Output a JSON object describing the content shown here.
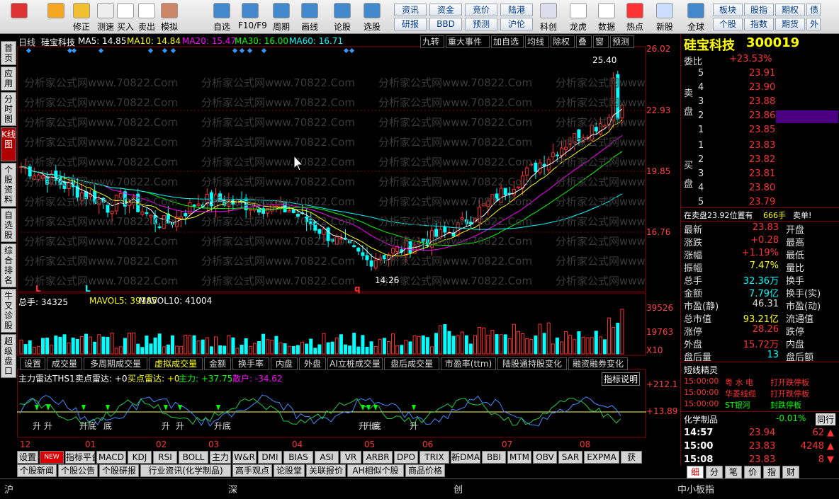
{
  "toolbar": {
    "items": [
      {
        "label": "",
        "icon": "windows-icon"
      },
      {
        "label": "",
        "icon": "back-arrow-icon"
      },
      {
        "label": "修正",
        "icon": "repair-icon"
      },
      {
        "label": "测速",
        "icon": "clock-icon"
      },
      {
        "label": "买入",
        "icon": "buy-icon"
      },
      {
        "label": "卖出",
        "icon": "sell-icon"
      },
      {
        "label": "模拟",
        "icon": "hammer-icon"
      },
      {
        "label": "自选",
        "icon": "star-icon"
      },
      {
        "label": "F10/F9",
        "icon": "f10-icon"
      },
      {
        "label": "周期",
        "icon": "period-clock-icon"
      },
      {
        "label": "画线",
        "icon": "pencil-icon"
      },
      {
        "label": "论股",
        "icon": "discuss-icon"
      },
      {
        "label": "选股",
        "icon": "speedometer-icon"
      }
    ],
    "grid": [
      [
        "资讯",
        "资金",
        "竞价",
        "陆港"
      ],
      [
        "研报",
        "BBD",
        "预测",
        "沪伦"
      ]
    ],
    "right_items": [
      {
        "label": "科创",
        "icon": "chart-icon"
      },
      {
        "label": "龙虎",
        "icon": "dragon-icon"
      },
      {
        "label": "数据",
        "icon": "pe-icon"
      },
      {
        "label": "热点",
        "icon": "hot-icon"
      },
      {
        "label": "新股",
        "icon": "new-stock-icon"
      },
      {
        "label": "全球",
        "icon": "globe-icon"
      }
    ],
    "grid2": [
      [
        "板块",
        "股指",
        "期权",
        "债"
      ],
      [
        "个股",
        "指数",
        "期货",
        "外"
      ]
    ]
  },
  "left_tabs": [
    "首页",
    "应用",
    "分时图",
    "K线图",
    "个股资料",
    "自选股",
    "综合排名",
    "牛叉诊股",
    "超级盘口"
  ],
  "chart_header": {
    "period": "日线",
    "name": "硅宝科技",
    "ma5": "MA5: 14.85",
    "ma10": "MA10: 14.84",
    "ma20": "MA20: 15.47",
    "ma30": "MA30: 16.00",
    "ma60": "MA60: 16.71",
    "buttons": [
      "九转",
      "重大事件",
      "加自选",
      "均线",
      "除权",
      "叠",
      "窗",
      "预测"
    ]
  },
  "watermark": "分析家公式网www.70822.Com",
  "price_axis": [
    "26.02",
    "22.93",
    "19.85",
    "16.76"
  ],
  "annotations": {
    "high": "25.40",
    "low": "14.26",
    "markers": [
      "L",
      "L",
      "q"
    ]
  },
  "volume_header": {
    "total": "总手: 34325",
    "mavol5": "MAVOL5: 39185",
    "mavol10": "MAVOL10: 41004"
  },
  "volume_axis": [
    "39526",
    "19763",
    "X10"
  ],
  "indicator_tabs": [
    "设置",
    "成交量",
    "多周期成交量",
    "虚拟成交量",
    "金额",
    "换手率",
    "内盘",
    "外盘",
    "AI立桩成交量",
    "盘后成交量",
    "市盈率(ttm)",
    "陆股通持股变化",
    "融资融券变化"
  ],
  "radar_header": {
    "title": "主力雷达THS1",
    "s1": "卖点雷达: +0",
    "s2": "买点雷达: +0",
    "s3": "主力: +37.75",
    "s4": "散户: -34.62",
    "explain": "指标说明"
  },
  "radar_axis": [
    "+212.1",
    "+13.89"
  ],
  "radar_labels": [
    "升",
    "升",
    "升底",
    "底",
    "升",
    "升",
    "升底",
    "升",
    "升底",
    "底",
    "升"
  ],
  "months": [
    "12",
    "01",
    "02",
    "03",
    "04",
    "05",
    "06",
    "07",
    "08"
  ],
  "bottom_tabs": [
    "设置",
    "NEW",
    "指标平台",
    "MACD",
    "KDJ",
    "RSI",
    "BOLL",
    "主力",
    "W&R",
    "DMI",
    "BIAS",
    "ASI",
    "VR",
    "ARBR",
    "DPO",
    "TRIX",
    "新DMA",
    "BBI",
    "MTM",
    "OBV",
    "SAR",
    "EXPMA",
    "获"
  ],
  "news_tabs": [
    "个股新闻",
    "个股公告",
    "个股研报",
    "行业资讯(化学制品)",
    "高手观点",
    "论股堂",
    "关联报价",
    "AH相似个股",
    "商品价格"
  ],
  "stock": {
    "name": "硅宝科技",
    "code": "300019"
  },
  "orderbook": {
    "weibi_label": "委比",
    "weibi": "+23.53%",
    "sell_label": "卖盘",
    "buy_label": "买盘",
    "sell": [
      {
        "lvl": "5",
        "price": "23.91"
      },
      {
        "lvl": "4",
        "price": "23.90"
      },
      {
        "lvl": "3",
        "price": "23.88"
      },
      {
        "lvl": "2",
        "price": "23.86"
      },
      {
        "lvl": "1",
        "price": "23.85"
      }
    ],
    "buy": [
      {
        "lvl": "1",
        "price": "23.83"
      },
      {
        "lvl": "2",
        "price": "23.82"
      },
      {
        "lvl": "3",
        "price": "23.81"
      },
      {
        "lvl": "4",
        "price": "23.80"
      },
      {
        "lvl": "5",
        "price": "23.79"
      }
    ],
    "info": "在卖盘23.92位置有",
    "info_vol": "666手",
    "info_tag": "卖单!"
  },
  "quote": [
    {
      "l": "最新",
      "v": "23.83",
      "r": "开盘"
    },
    {
      "l": "涨跌",
      "v": "+0.28",
      "r": "最高"
    },
    {
      "l": "涨幅",
      "v": "+1.19%",
      "r": "最低"
    },
    {
      "l": "振幅",
      "v": "7.47%",
      "r": "量比"
    },
    {
      "l": "总手",
      "v": "32.36万",
      "r": "换手"
    },
    {
      "l": "金额",
      "v": "7.79亿",
      "r": "换手(实)"
    },
    {
      "l": "市盈(静)",
      "v": "46.31",
      "r": "市盈(动)"
    },
    {
      "l": "总市值",
      "v": "93.21亿",
      "r": "流通值"
    },
    {
      "l": "涨停",
      "v": "28.26",
      "r": "跌停"
    },
    {
      "l": "外盘",
      "v": "15.72万",
      "r": "内盘"
    },
    {
      "l": "盘后量",
      "v": "13",
      "r": "盘后额"
    }
  ],
  "short_title": "短线精灵",
  "short_list": [
    {
      "t": "15:00:00",
      "n": "粤 水 电",
      "e": "打开跌停板"
    },
    {
      "t": "15:00:00",
      "n": "华菱线缆",
      "e": "打开跌停板"
    },
    {
      "t": "15:00:00",
      "n": "ST银河",
      "e": "封跌停板"
    }
  ],
  "sector": {
    "name": "化学制品",
    "chg": "-0.01%",
    "tab": "同行"
  },
  "ticks": [
    {
      "t": "14:57",
      "p": "23.94",
      "v": "62"
    },
    {
      "t": "15:00",
      "p": "23.83",
      "v": "4248"
    },
    {
      "t": "15:08",
      "p": "23.83",
      "v": "8"
    }
  ],
  "right_tabs": [
    "细",
    "分",
    "笔",
    "价",
    "指",
    "财"
  ],
  "statusbar": {
    "sh": "沪",
    "sz": "深",
    "cy": "创",
    "zx": "中小板指"
  },
  "colors": {
    "up": "#ff3030",
    "down": "#00ffff",
    "ma5": "#ffffff",
    "ma10": "#ffff00",
    "ma20": "#ff00ff",
    "ma30": "#00ff00",
    "ma60": "#00ffff"
  }
}
